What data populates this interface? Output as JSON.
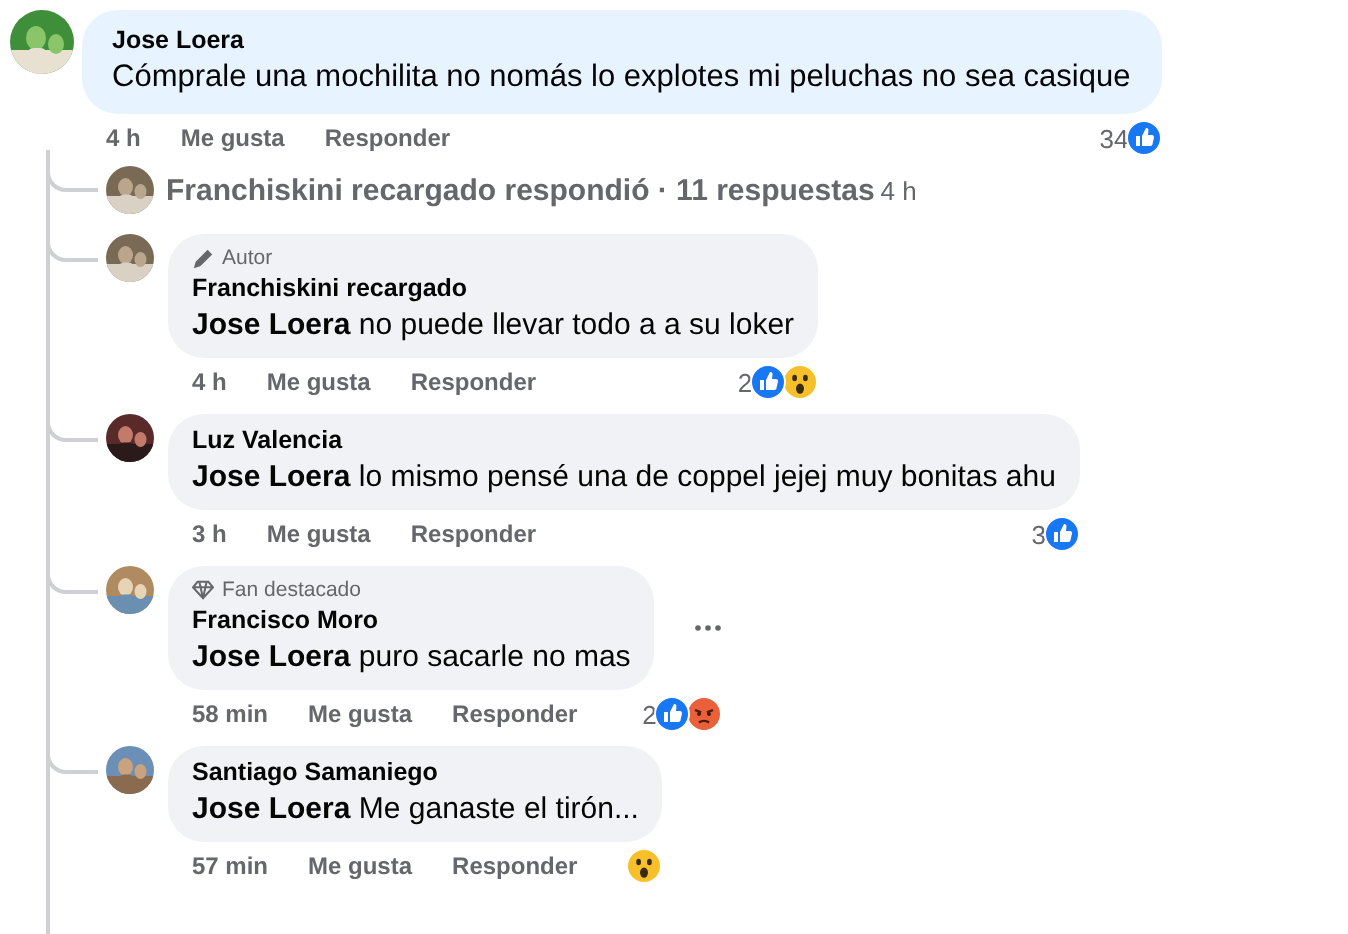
{
  "comment": {
    "author": "Jose Loera",
    "text": "Cómprale una mochilita no nomás lo explotes mi peluchas no sea casique",
    "time": "4 h",
    "like_label": "Me gusta",
    "reply_label": "Responder",
    "reaction_count": "34",
    "reactions": [
      {
        "kind": "like"
      }
    ]
  },
  "replies_summary": {
    "text": "Franchiskini recargado respondió · 11 respuestas",
    "time": "4 h"
  },
  "replies": [
    {
      "badge": {
        "kind": "author",
        "label": "Autor"
      },
      "author": "Franchiskini recargado",
      "text": "**Jose Loera** no puede llevar todo a a su loker",
      "time": "4 h",
      "like_label": "Me gusta",
      "reply_label": "Responder",
      "reaction_count": "2",
      "reactions": [
        {
          "kind": "like"
        },
        {
          "kind": "wow"
        }
      ],
      "menu": false
    },
    {
      "author": "Luz Valencia",
      "text": "**Jose Loera** lo mismo pensé una de coppel jejej muy bonitas ahu",
      "time": "3 h",
      "like_label": "Me gusta",
      "reply_label": "Responder",
      "reaction_count": "3",
      "reactions": [
        {
          "kind": "like"
        }
      ],
      "menu": false
    },
    {
      "badge": {
        "kind": "top-fan",
        "label": "Fan destacado"
      },
      "author": "Francisco Moro",
      "text": "**Jose Loera** puro sacarle no mas",
      "time": "58 min",
      "like_label": "Me gusta",
      "reply_label": "Responder",
      "reaction_count": "2",
      "reactions": [
        {
          "kind": "like"
        },
        {
          "kind": "angry"
        }
      ],
      "menu": true
    },
    {
      "author": "Santiago Samaniego",
      "text": "**Jose Loera** Me ganaste el tirón...",
      "time": "57 min",
      "like_label": "Me gusta",
      "reply_label": "Responder",
      "reactions": [
        {
          "kind": "wow"
        }
      ],
      "menu": false
    }
  ]
}
